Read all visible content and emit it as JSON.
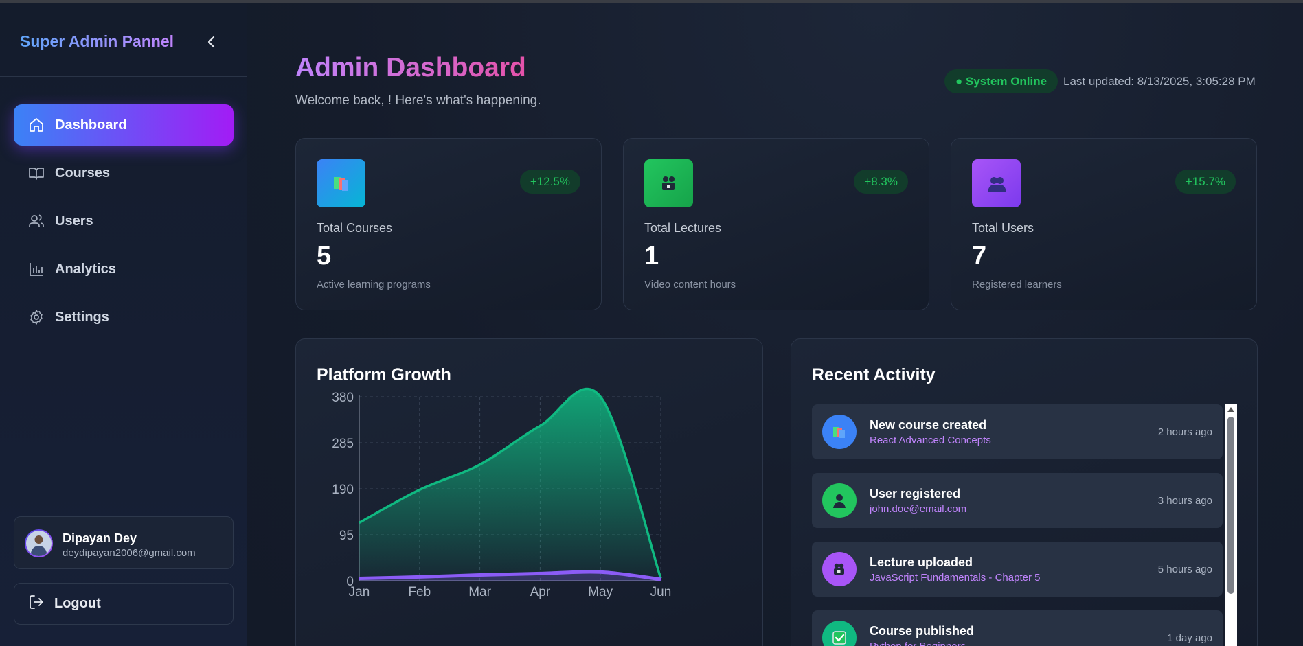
{
  "sidebar": {
    "brand": "Super Admin Pannel",
    "items": [
      {
        "label": "Dashboard",
        "icon": "home-icon",
        "active": true
      },
      {
        "label": "Courses",
        "icon": "book-icon"
      },
      {
        "label": "Users",
        "icon": "users-icon"
      },
      {
        "label": "Analytics",
        "icon": "bar-chart-icon"
      },
      {
        "label": "Settings",
        "icon": "gear-icon"
      }
    ],
    "user": {
      "name": "Dipayan Dey",
      "email": "deydipayan2006@gmail.com"
    },
    "logout_label": "Logout"
  },
  "header": {
    "title": "Admin Dashboard",
    "subtitle": "Welcome back, ! Here's what's happening.",
    "status": "● System Online",
    "last_updated": "Last updated: 8/13/2025, 3:05:28 PM"
  },
  "stats": [
    {
      "label": "Total Courses",
      "value": "5",
      "desc": "Active learning programs",
      "change": "+12.5%",
      "icon": "books-icon",
      "color": "#3b82f6"
    },
    {
      "label": "Total Lectures",
      "value": "1",
      "desc": "Video content hours",
      "change": "+8.3%",
      "icon": "video-camera-icon",
      "color": "#22c55e"
    },
    {
      "label": "Total Users",
      "value": "7",
      "desc": "Registered learners",
      "change": "+15.7%",
      "icon": "users-icon",
      "color": "#a855f7"
    }
  ],
  "growth": {
    "title": "Platform Growth"
  },
  "chart_data": {
    "type": "area",
    "title": "Platform Growth",
    "categories": [
      "Jan",
      "Feb",
      "Mar",
      "Apr",
      "May",
      "Jun"
    ],
    "yticks": [
      0,
      95,
      190,
      285,
      380
    ],
    "ylim": [
      0,
      380
    ],
    "grid": true,
    "series": [
      {
        "values": [
          120,
          188,
          240,
          320,
          380,
          5
        ],
        "color": "#10b981"
      },
      {
        "values": [
          5,
          8,
          12,
          15,
          18,
          3
        ],
        "color": "#8b5cf6"
      }
    ]
  },
  "activity": {
    "title": "Recent Activity",
    "items": [
      {
        "title": "New course created",
        "sub": "React Advanced Concepts",
        "time": "2 hours ago",
        "icon": "books-icon",
        "color": "#3b82f6"
      },
      {
        "title": "User registered",
        "sub": "john.doe@email.com",
        "time": "3 hours ago",
        "icon": "user-icon",
        "color": "#22c55e"
      },
      {
        "title": "Lecture uploaded",
        "sub": "JavaScript Fundamentals - Chapter 5",
        "time": "5 hours ago",
        "icon": "video-camera-icon",
        "color": "#a855f7"
      },
      {
        "title": "Course published",
        "sub": "Python for Beginners",
        "time": "1 day ago",
        "icon": "check-icon",
        "color": "#10b981"
      }
    ]
  }
}
